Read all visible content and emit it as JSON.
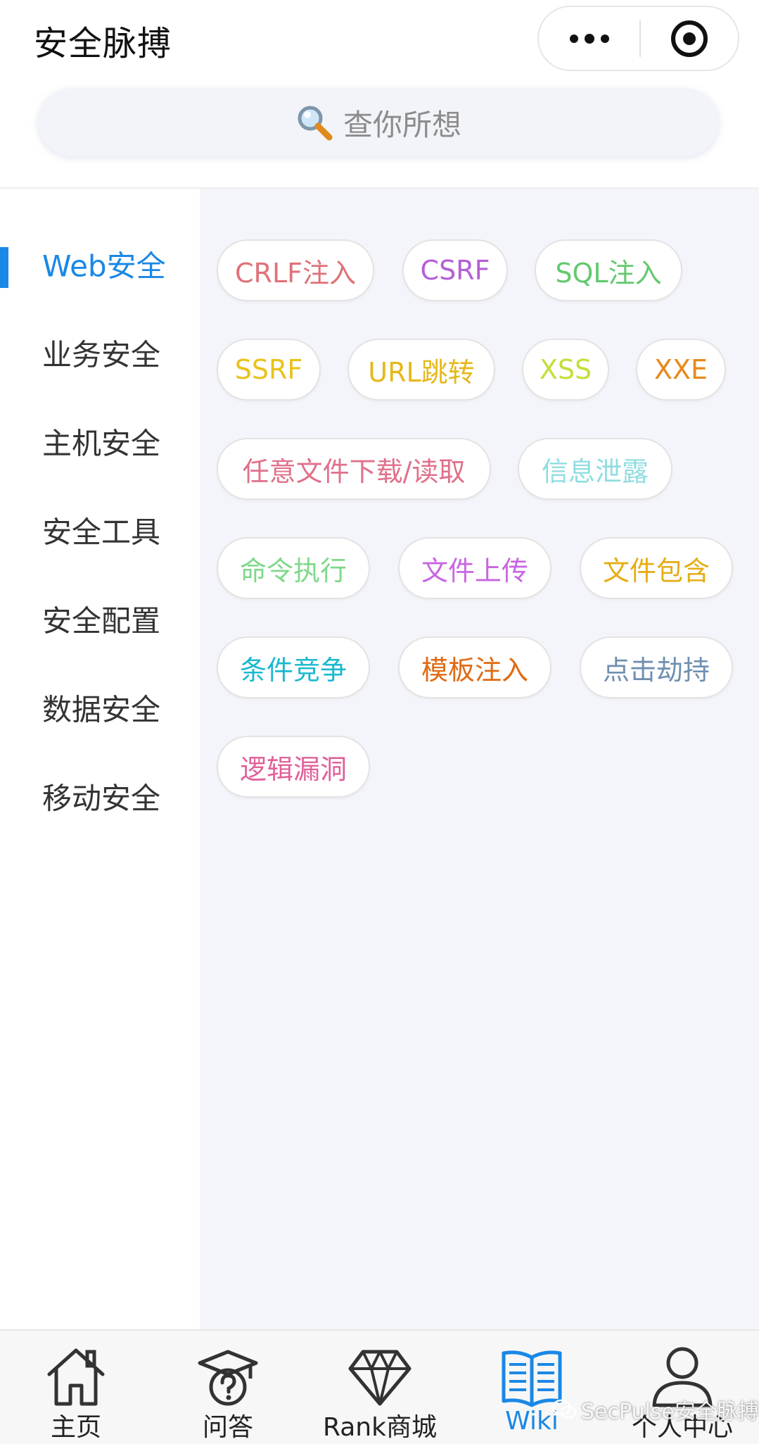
{
  "app": {
    "title": "安全脉搏"
  },
  "capsule": {
    "more_icon": "more-dots-icon",
    "close_icon": "target-circle-icon"
  },
  "search": {
    "icon": "magnifier-icon",
    "placeholder": "查你所想"
  },
  "sidebar": {
    "items": [
      {
        "label": "Web安全",
        "active": true
      },
      {
        "label": "业务安全",
        "active": false
      },
      {
        "label": "主机安全",
        "active": false
      },
      {
        "label": "安全工具",
        "active": false
      },
      {
        "label": "安全配置",
        "active": false
      },
      {
        "label": "数据安全",
        "active": false
      },
      {
        "label": "移动安全",
        "active": false
      }
    ]
  },
  "tags": [
    {
      "label": "CRLF注入",
      "color": "#e0727a"
    },
    {
      "label": "CSRF",
      "color": "#b45fd6"
    },
    {
      "label": "SQL注入",
      "color": "#63c96e"
    },
    {
      "label": "SSRF",
      "color": "#e9c21d"
    },
    {
      "label": "URL跳转",
      "color": "#e5b81b"
    },
    {
      "label": "XSS",
      "color": "#c6dd3c"
    },
    {
      "label": "XXE",
      "color": "#e8891b"
    },
    {
      "label": "任意文件下载/读取",
      "color": "#e0708a"
    },
    {
      "label": "信息泄露",
      "color": "#8fdde0"
    },
    {
      "label": "命令执行",
      "color": "#7fd88a"
    },
    {
      "label": "文件上传",
      "color": "#c766e0"
    },
    {
      "label": "文件包含",
      "color": "#e5ad16"
    },
    {
      "label": "条件竞争",
      "color": "#1ab8d0"
    },
    {
      "label": "模板注入",
      "color": "#e06a12"
    },
    {
      "label": "点击劫持",
      "color": "#6f8fb0"
    },
    {
      "label": "逻辑漏洞",
      "color": "#e0609a"
    }
  ],
  "tabbar": {
    "tabs": [
      {
        "label": "主页",
        "icon": "home-icon",
        "active": false
      },
      {
        "label": "问答",
        "icon": "question-cap-icon",
        "active": false
      },
      {
        "label": "Rank商城",
        "icon": "diamond-icon",
        "active": false
      },
      {
        "label": "Wiki",
        "icon": "book-icon",
        "active": true
      },
      {
        "label": "个人中心",
        "icon": "person-icon",
        "active": false
      }
    ]
  },
  "watermark": {
    "text": "SecPulse安全脉搏",
    "icon": "wechat-icon"
  },
  "colors": {
    "accent": "#1a88e6",
    "content_bg": "#f4f5fa"
  }
}
